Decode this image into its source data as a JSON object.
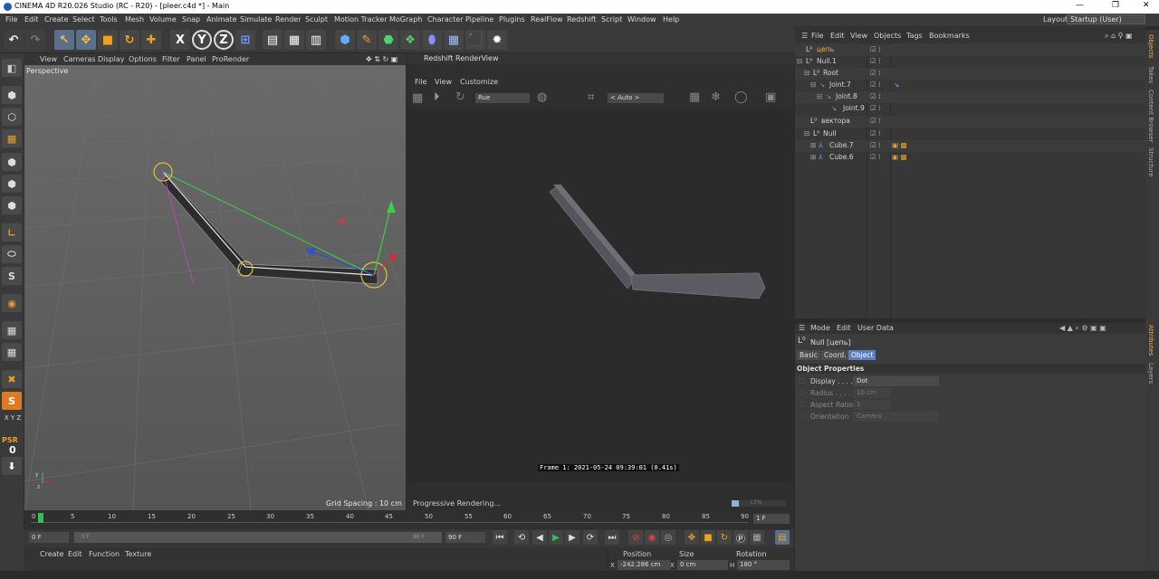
{
  "window": {
    "title": "CINEMA 4D R20.026 Studio (RC - R20) - [pleer.c4d *] - Main",
    "minimize": "—",
    "restore": "❐",
    "close": "✕"
  },
  "menubar": {
    "items": [
      "File",
      "Edit",
      "Create",
      "Select",
      "Tools",
      "Mesh",
      "Volume",
      "Snap",
      "Animate",
      "Simulate",
      "Render",
      "Sculpt",
      "Motion Tracker",
      "MoGraph",
      "Character",
      "Pipeline",
      "Plugins",
      "RealFlow",
      "Redshift",
      "Script",
      "Window",
      "Help"
    ],
    "layout_label": "Layout:",
    "layout_value": "Startup (User)"
  },
  "toolbar": {
    "axis_x": "X",
    "axis_y": "Y",
    "axis_z": "Z"
  },
  "palette": {
    "s_label": "S",
    "xyz_label": "X Y Z",
    "psr_label": "PSR",
    "psr_value": "0"
  },
  "viewport": {
    "menu": [
      "View",
      "Cameras",
      "Display",
      "Options",
      "Filter",
      "Panel",
      "ProRender"
    ],
    "label": "Perspective",
    "grid_spacing": "Grid Spacing : 10 cm",
    "axis_y": "y",
    "axis_z": "z"
  },
  "renderview": {
    "title": "Redshift RenderView",
    "menu": [
      "File",
      "View",
      "Customize"
    ],
    "beauty_select": "Rue",
    "camera_select": "< Auto >",
    "frame_info": "Frame 1: 2021-05-24 09:39:01 (0.41s)",
    "status": "Progressive Rendering...",
    "percent": "13%"
  },
  "object_manager": {
    "menu": [
      "File",
      "Edit",
      "View",
      "Objects",
      "Tags",
      "Bookmarks"
    ],
    "rows": [
      {
        "name": "цепь",
        "highlight": true
      },
      {
        "name": "Null.1",
        "highlight": false
      },
      {
        "name": "Root",
        "highlight": false
      },
      {
        "name": "Joint.7",
        "highlight": false
      },
      {
        "name": "Joint.8",
        "highlight": false
      },
      {
        "name": "Joint.9",
        "highlight": false
      },
      {
        "name": "вектора",
        "highlight": false
      },
      {
        "name": "Null",
        "highlight": false
      },
      {
        "name": "Cube.7",
        "highlight": false
      },
      {
        "name": "Cube.6",
        "highlight": false
      }
    ]
  },
  "attributes": {
    "menu": [
      "Mode",
      "Edit",
      "User Data"
    ],
    "object_title": "Null [цепь]",
    "tabs": [
      "Basic",
      "Coord.",
      "Object"
    ],
    "section": "Object Properties",
    "props": [
      {
        "label": "Display . . . .",
        "value": "Dot",
        "dim": false
      },
      {
        "label": "Radius . . . .",
        "value": "10 cm",
        "dim": true
      },
      {
        "label": "Aspect Ratio",
        "value": "1",
        "dim": true
      },
      {
        "label": "Orientation",
        "value": "Camera",
        "dim": true
      }
    ]
  },
  "side_tabs": [
    "Objects",
    "Takes",
    "Content Browser",
    "Structure",
    "Attributes",
    "Layers"
  ],
  "timeline": {
    "ticks": [
      "0",
      "5",
      "10",
      "15",
      "20",
      "25",
      "30",
      "35",
      "40",
      "45",
      "50",
      "55",
      "60",
      "65",
      "70",
      "75",
      "80",
      "85",
      "90"
    ],
    "end_field": "1 F",
    "current": "0 F",
    "slider_start": "0 F",
    "slider_end": "90 F",
    "max_field": "90 F"
  },
  "material": {
    "menu": [
      "Create",
      "Edit",
      "Function",
      "Texture"
    ]
  },
  "coordinates": {
    "headers": [
      "Position",
      "Size",
      "Rotation"
    ],
    "x_label": "X",
    "x_pos": "-242.286 cm",
    "x_size_label": "X",
    "x_size": "0 cm",
    "h_label": "H",
    "h_rot": "180 °"
  },
  "colors": {
    "accent": "#5a7ec2",
    "highlight_text": "#f3b03a",
    "timeline_cursor": "#33c05a",
    "viewport_bg": "#5a5a5a",
    "render_bg": "#2b2b2b"
  }
}
